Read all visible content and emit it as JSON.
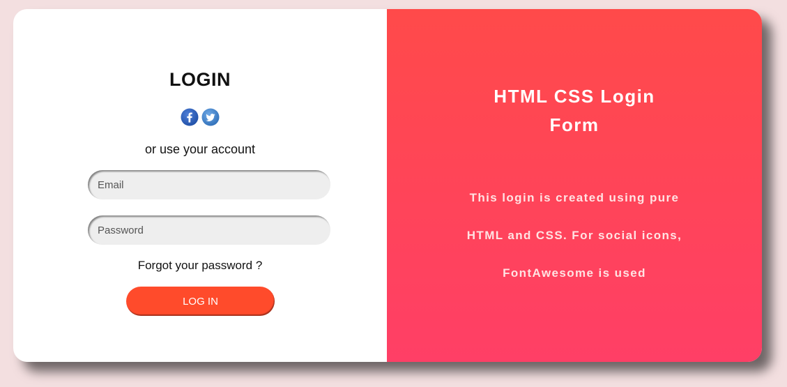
{
  "login": {
    "title": "LOGIN",
    "social": [
      {
        "name": "facebook-icon",
        "glyph": "f",
        "color": "#3b5998"
      },
      {
        "name": "twitter-icon",
        "glyph": "twitter",
        "color": "#1da1f2"
      }
    ],
    "alt_text": "or use your account",
    "email_placeholder": "Email",
    "password_placeholder": "Password",
    "forgot_text": "Forgot your password ?",
    "button_label": "LOG IN"
  },
  "panel": {
    "title_line1": "HTML CSS Login",
    "title_line2": "Form",
    "desc_line1": "This login is created using pure",
    "desc_line2": "HTML and CSS. For social icons,",
    "desc_line3": "FontAwesome is used"
  },
  "colors": {
    "background": "#f3dfe0",
    "accent": "#ff4b2b",
    "panel_gradient_top": "#ff4a4a",
    "panel_gradient_bottom": "#ff3f66"
  }
}
